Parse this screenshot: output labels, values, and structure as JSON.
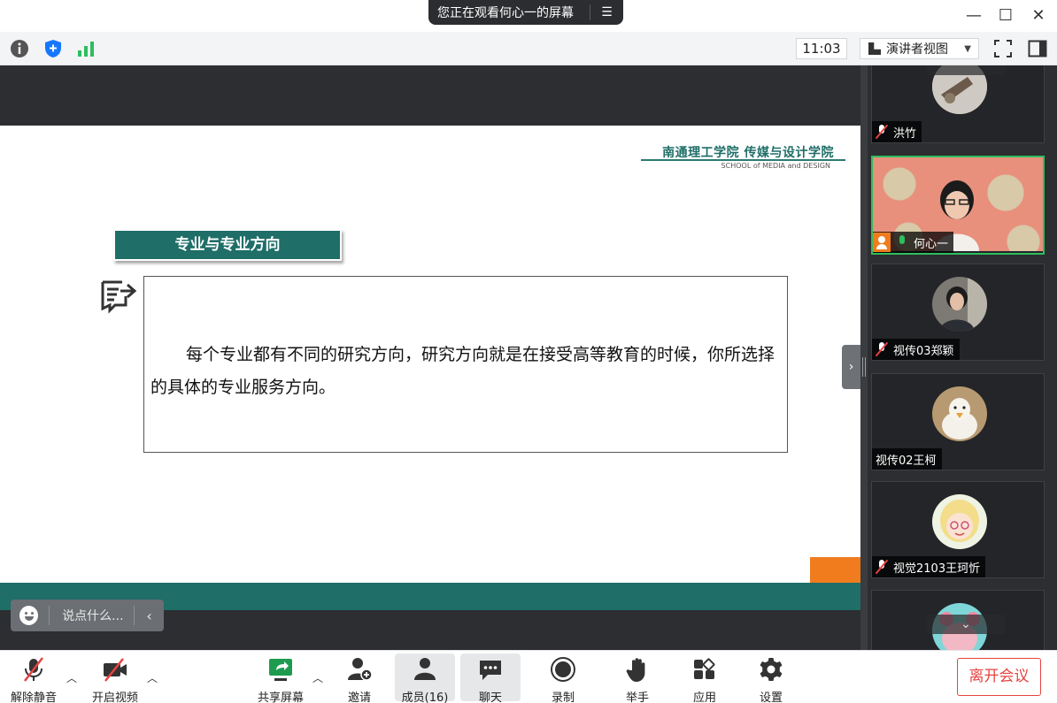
{
  "share_banner": {
    "text": "您正在观看何心一的屏幕",
    "menu_icon": "menu-lines-icon"
  },
  "window": {
    "minimize": "—",
    "maximize": "☐",
    "close": "✕"
  },
  "infobar": {
    "time": "11:03",
    "view_mode": "演讲者视图"
  },
  "slide": {
    "school_name": "南通理工学院 传媒与设计学院",
    "school_en": "SCHOOL of MEDIA and DESIGN",
    "heading": "专业与专业方向",
    "body": "每个专业都有不同的研究方向，研究方向就是在接受高等教育的时候，你所选择的具体的专业服务方向。",
    "colors": {
      "teal": "#1f6e68",
      "orange": "#f07c1e"
    }
  },
  "chat_input": {
    "placeholder": "说点什么..."
  },
  "participants": [
    {
      "name": "洪竹",
      "mic": "muted"
    },
    {
      "name": "何心一",
      "mic": "on",
      "host": true,
      "active": true
    },
    {
      "name": "视传03郑颖",
      "mic": "muted"
    },
    {
      "name": "视传02王柯",
      "mic": "none"
    },
    {
      "name": "视觉2103王珂忻",
      "mic": "muted"
    },
    {
      "name": "",
      "mic": "none"
    }
  ],
  "toolbar": {
    "unmute": "解除静音",
    "start_video": "开启视频",
    "share_screen": "共享屏幕",
    "invite": "邀请",
    "members": "成员(16)",
    "chat": "聊天",
    "record": "录制",
    "raise_hand": "举手",
    "apps": "应用",
    "settings": "设置",
    "leave": "离开会议"
  }
}
